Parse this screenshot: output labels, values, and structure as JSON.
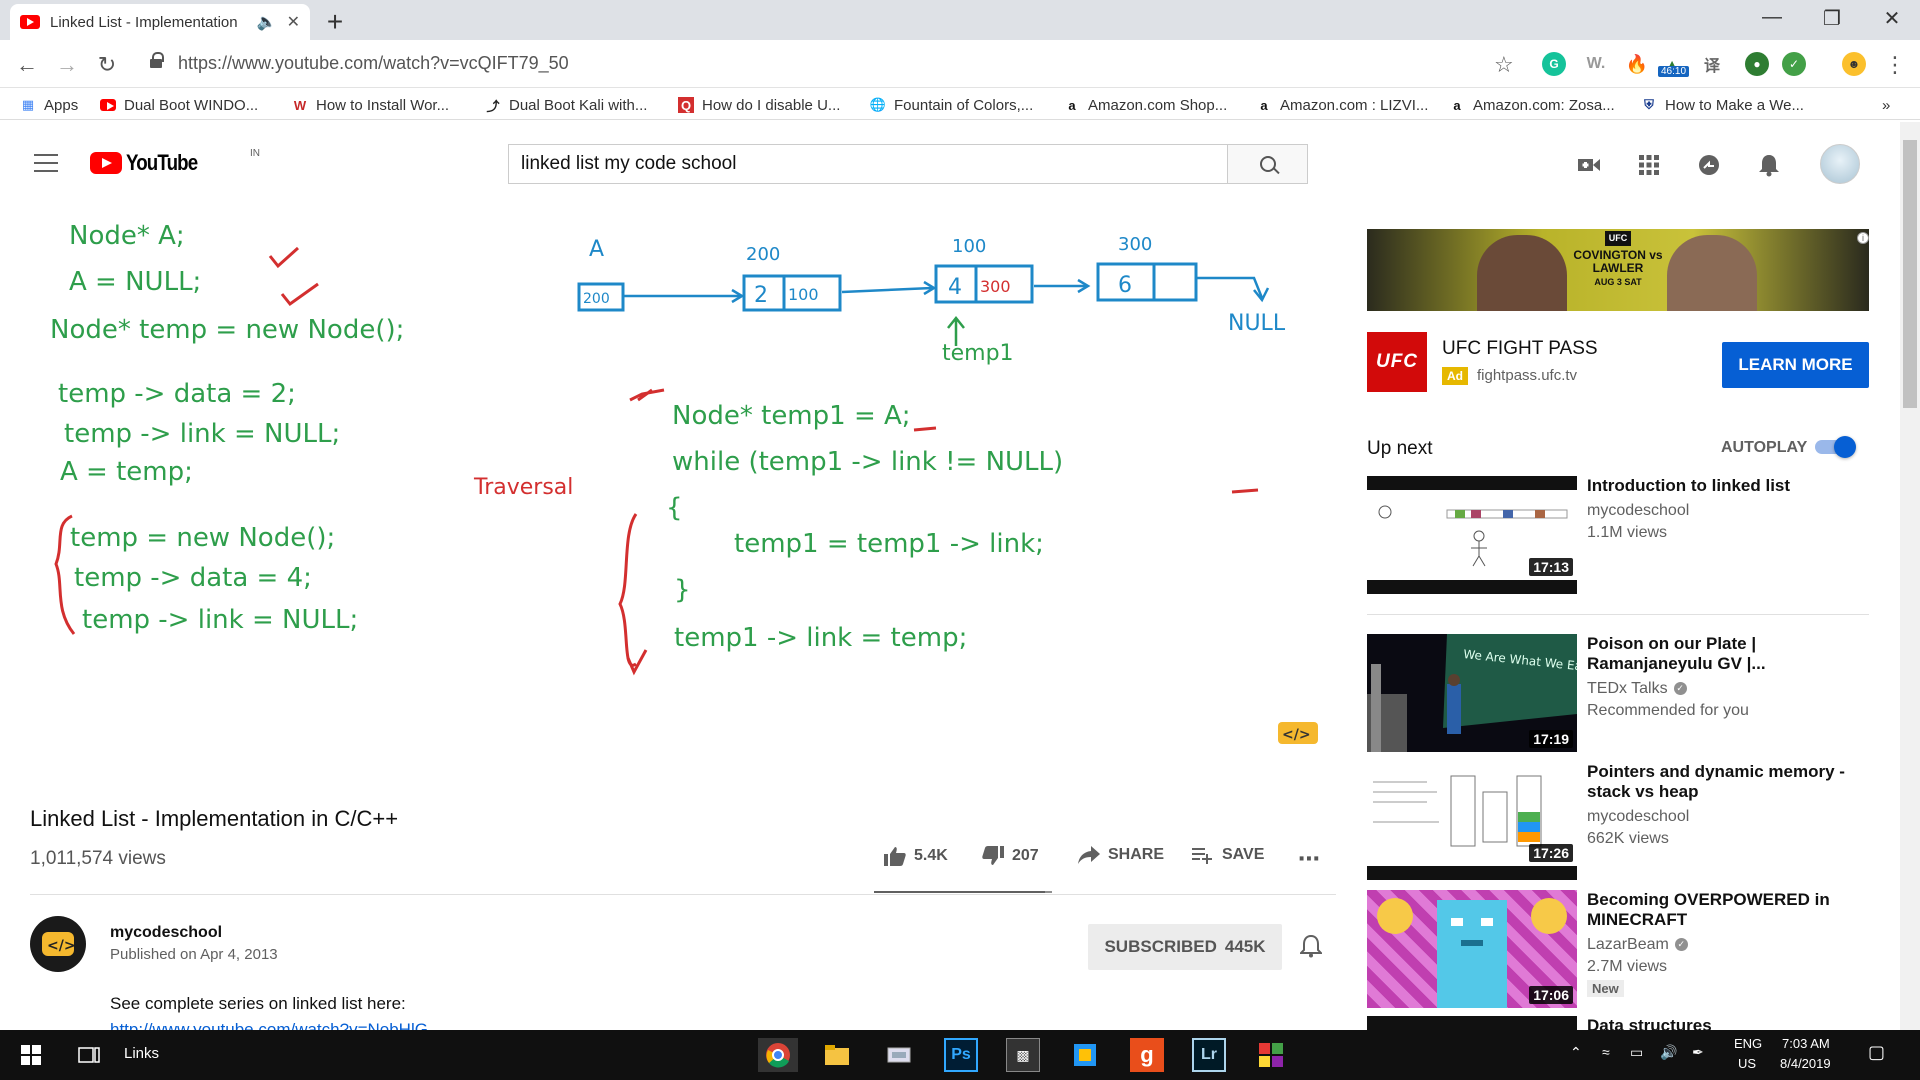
{
  "browser": {
    "tab_title": "Linked List - Implementation",
    "url": "https://www.youtube.com/watch?v=vcQIFT79_50",
    "ext_timer": "46:10",
    "bookmarks": [
      "Apps",
      "Dual Boot WINDO...",
      "How to Install Wor...",
      "Dual Boot Kali with...",
      "How do I disable U...",
      "Fountain of Colors,...",
      "Amazon.com Shop...",
      "Amazon.com : LIZVI...",
      "Amazon.com: Zosa...",
      "How to Make a We..."
    ],
    "bookmarks_more": "»"
  },
  "youtube": {
    "logo_text": "YouTube",
    "country_code": "IN",
    "search_query": "linked list my code school"
  },
  "video": {
    "board": {
      "left_code": [
        "Node* A;",
        "A = NULL;",
        "Node* temp = new Node();",
        "temp -> data = 2;",
        "temp -> link = NULL;",
        "A = temp;",
        "temp = new Node();",
        "temp -> data = 4;",
        "temp -> link = NULL;"
      ],
      "traversal_label": "Traversal",
      "traversal_code": [
        "Node* temp1 = A;",
        "while (temp1 -> link != NULL)",
        "{",
        "temp1 = temp1 -> link;",
        "}",
        "temp1 -> link = temp;"
      ],
      "list_head_label": "A",
      "list_head_value": "200",
      "nodes": [
        {
          "address": "200",
          "data": "2",
          "link": "100"
        },
        {
          "address": "100",
          "data": "4",
          "link": "300"
        },
        {
          "address": "300",
          "data": "6",
          "link": ""
        }
      ],
      "pointer_label": "temp1",
      "null_label": "NULL"
    },
    "title": "Linked List - Implementation in C/C++",
    "views": "1,011,574 views",
    "likes": "5.4K",
    "dislikes": "207",
    "share_label": "SHARE",
    "save_label": "SAVE",
    "like_ratio": 0.963
  },
  "channel": {
    "name": "mycodeschool",
    "published": "Published on Apr 4, 2013",
    "subscribe_label": "SUBSCRIBED",
    "subscriber_count": "445K",
    "description": "See complete series on linked list here:",
    "description_link": "http://www.youtube.com/watch?v=NobHlG"
  },
  "ad": {
    "banner_event": "COVINGTON vs LAWLER",
    "banner_date": "AUG 3 SAT",
    "logo_text": "UFC",
    "title": "UFC FIGHT PASS",
    "badge": "Ad",
    "domain": "fightpass.ufc.tv",
    "cta": "LEARN MORE"
  },
  "sidebar": {
    "up_next": "Up next",
    "autoplay": "AUTOPLAY",
    "autoplay_on": true,
    "items": [
      {
        "title": "Introduction to linked list",
        "channel": "mycodeschool",
        "meta": "1.1M views",
        "duration": "17:13"
      },
      {
        "title": "Poison on our Plate | Ramanjaneyulu GV |...",
        "channel": "TEDx Talks",
        "meta": "Recommended for you",
        "duration": "17:19",
        "thumb_text": "We Are What We Eat"
      },
      {
        "title": "Pointers and dynamic memory - stack vs heap",
        "channel": "mycodeschool",
        "meta": "662K views",
        "duration": "17:26"
      },
      {
        "title": "Becoming OVERPOWERED in MINECRAFT",
        "channel": "LazarBeam",
        "meta": "2.7M views",
        "duration": "17:06",
        "badge": "New"
      },
      {
        "title": "Data structures"
      }
    ]
  },
  "taskbar": {
    "search_label": "Links",
    "lang": "ENG",
    "region": "US",
    "time": "7:03 AM",
    "date": "8/4/2019"
  }
}
